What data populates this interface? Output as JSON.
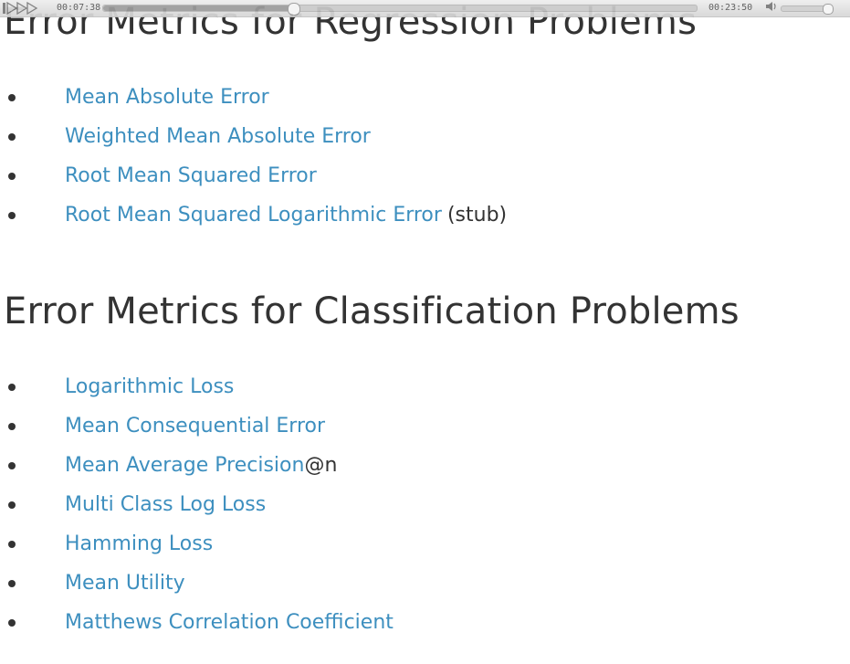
{
  "player": {
    "current_time": "00:07:38",
    "total_time": "00:23:50",
    "progress": 0.32,
    "volume": 0.9
  },
  "regression": {
    "title": "Error Metrics for Regression Problems",
    "items": [
      {
        "label": "Mean Absolute Error",
        "suffix": ""
      },
      {
        "label": "Weighted Mean Absolute Error",
        "suffix": ""
      },
      {
        "label": "Root Mean Squared Error",
        "suffix": ""
      },
      {
        "label": "Root Mean Squared Logarithmic Error",
        "suffix": "(stub)"
      }
    ]
  },
  "classification": {
    "title": "Error Metrics for Classification Problems",
    "items": [
      {
        "label": "Logarithmic Loss",
        "suffix": ""
      },
      {
        "label": "Mean Consequential Error",
        "suffix": ""
      },
      {
        "label": "Mean Average Precision",
        "suffix": "@n"
      },
      {
        "label": "Multi Class Log Loss",
        "suffix": ""
      },
      {
        "label": "Hamming Loss",
        "suffix": ""
      },
      {
        "label": "Mean Utility",
        "suffix": ""
      },
      {
        "label": "Matthews Correlation Coefficient",
        "suffix": ""
      }
    ]
  },
  "colors": {
    "link": "#3d8fbf",
    "text": "#333333"
  }
}
